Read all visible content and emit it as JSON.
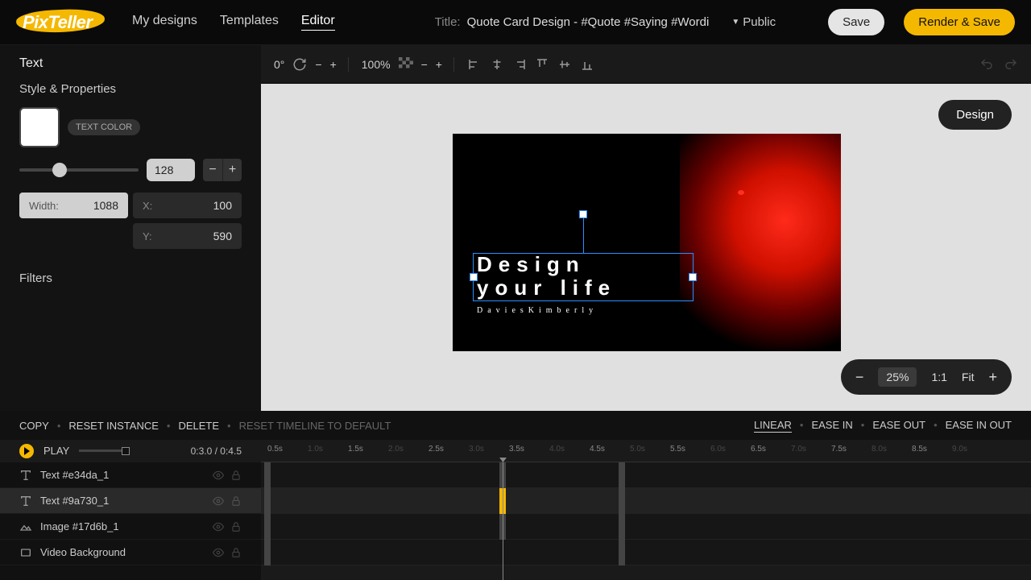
{
  "logo": "PixTeller",
  "nav": {
    "designs": "My designs",
    "templates": "Templates",
    "editor": "Editor"
  },
  "titleLabel": "Title:",
  "titleText": "Quote Card Design - #Quote #Saying #Wordi",
  "visibility": "Public",
  "buttons": {
    "save": "Save",
    "render": "Render & Save"
  },
  "sidebar": {
    "text": "Text",
    "style": "Style & Properties",
    "textColorBadge": "TEXT COLOR",
    "size": "128",
    "widthLabel": "Width:",
    "widthVal": "1088",
    "xLabel": "X:",
    "xVal": "100",
    "yLabel": "Y:",
    "yVal": "590",
    "filters": "Filters"
  },
  "toolbar": {
    "rotation": "0°",
    "opacity": "100%"
  },
  "designBtn": "Design",
  "canvas": {
    "line1": "Design",
    "line2": "your life",
    "author": "DaviesKimberly"
  },
  "zoom": {
    "pct": "25%",
    "ratio": "1:1",
    "fit": "Fit"
  },
  "actions": {
    "copy": "COPY",
    "reset": "RESET INSTANCE",
    "delete": "DELETE",
    "resetTimeline": "RESET TIMELINE TO DEFAULT",
    "linear": "LINEAR",
    "easeIn": "EASE IN",
    "easeOut": "EASE OUT",
    "easeInOut": "EASE IN OUT"
  },
  "play": {
    "label": "PLAY",
    "time": "0:3.0 / 0:4.5"
  },
  "layers": [
    {
      "name": "Text #e34da_1",
      "type": "text"
    },
    {
      "name": "Text #9a730_1",
      "type": "text",
      "selected": true
    },
    {
      "name": "Image #17d6b_1",
      "type": "image"
    },
    {
      "name": "Video Background",
      "type": "video"
    }
  ],
  "ticks": [
    "0.5s",
    "1.0s",
    "1.5s",
    "2.0s",
    "2.5s",
    "3.0s",
    "3.5s",
    "4.0s",
    "4.5s",
    "5.0s",
    "5.5s",
    "6.0s",
    "6.5s",
    "7.0s",
    "7.5s",
    "8.0s",
    "8.5s",
    "9.0s"
  ]
}
